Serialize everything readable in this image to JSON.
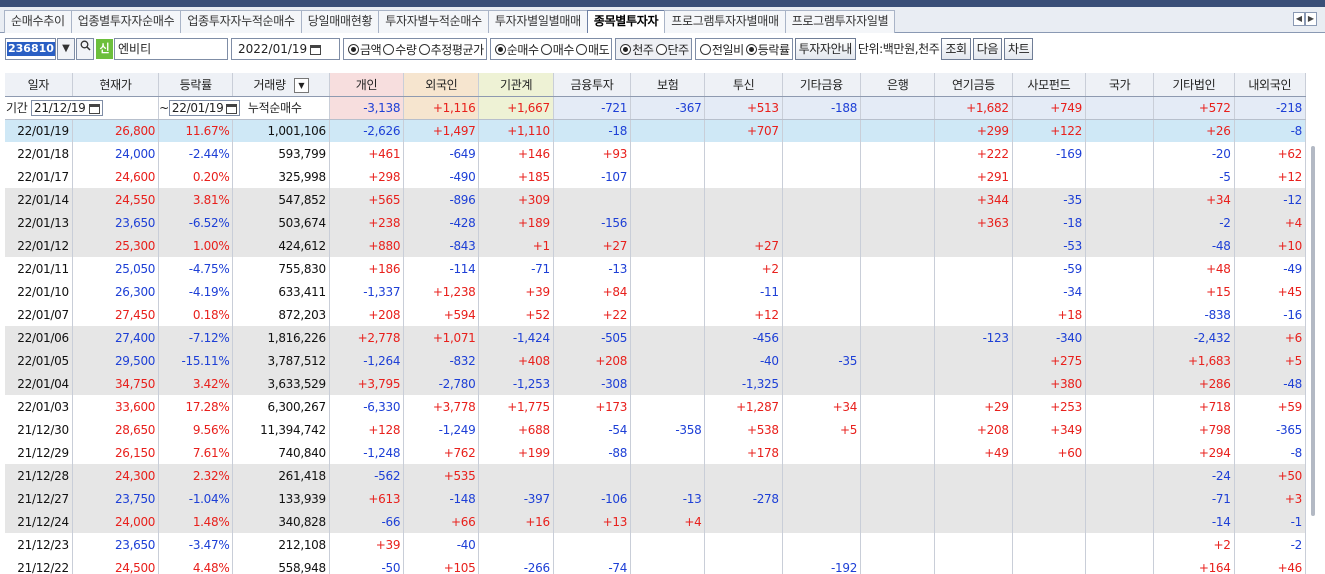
{
  "tabs": [
    {
      "label": "순매수추이",
      "active": false
    },
    {
      "label": "업종별투자자순매수",
      "active": false
    },
    {
      "label": "업종투자자누적순매수",
      "active": false
    },
    {
      "label": "당일매매현황",
      "active": false
    },
    {
      "label": "투자자별누적순매수",
      "active": false
    },
    {
      "label": "투자자별일별매매",
      "active": false
    },
    {
      "label": "종목별투자자",
      "active": true
    },
    {
      "label": "프로그램투자자별매매",
      "active": false
    },
    {
      "label": "프로그램투자자일별",
      "active": false
    }
  ],
  "tab_nav": {
    "prev": "◀",
    "next": "▶"
  },
  "toolbar": {
    "code": "236810",
    "dropdown_icon": "▼",
    "search_icon": "🔍",
    "credit_badge": "신",
    "stock_name": "엔비티",
    "date": "2022/01/19",
    "group1": [
      {
        "label": "금액",
        "on": true
      },
      {
        "label": "수량",
        "on": false
      },
      {
        "label": "추정평균가",
        "on": false
      }
    ],
    "group2": [
      {
        "label": "순매수",
        "on": true
      },
      {
        "label": "매수",
        "on": false
      },
      {
        "label": "매도",
        "on": false
      }
    ],
    "group3": [
      {
        "label": "천주",
        "on": true
      },
      {
        "label": "단주",
        "on": false
      }
    ],
    "group4": [
      {
        "label": "전일비",
        "on": false
      },
      {
        "label": "등락률",
        "on": true
      }
    ],
    "guide_button": "투자자안내",
    "unit": "단위:백만원,천주",
    "query_button": "조회",
    "next_button": "다음",
    "chart_button": "차트"
  },
  "period": {
    "label": "기간",
    "from": "21/12/19",
    "tilde": "~",
    "to": "22/01/19",
    "cumulative_label": "누적순매수"
  },
  "summary": [
    "-3,138",
    "+1,116",
    "+1,667",
    "-721",
    "-367",
    "+513",
    "-188",
    "",
    "+1,682",
    "+749",
    "",
    "+572",
    "-218"
  ],
  "headers": [
    "일자",
    "현재가",
    "등락률",
    "거래량",
    "개인",
    "외국인",
    "기관계",
    "금융투자",
    "보험",
    "투신",
    "기타금융",
    "은행",
    "연기금등",
    "사모펀드",
    "국가",
    "기타법인",
    "내외국인"
  ],
  "filter_icon": "▼",
  "rows": [
    {
      "d": "22/01/19",
      "style": "sel",
      "v": [
        "26,800",
        "11.67%",
        "1,001,106",
        "-2,626",
        "+1,497",
        "+1,110",
        "-18",
        "",
        "+707",
        "",
        "",
        "+299",
        "+122",
        "",
        "+26",
        "-8"
      ]
    },
    {
      "d": "22/01/18",
      "style": "",
      "v": [
        "24,000",
        "-2.44%",
        "593,799",
        "+461",
        "-649",
        "+146",
        "+93",
        "",
        "",
        "",
        "",
        "+222",
        "-169",
        "",
        "-20",
        "+62"
      ]
    },
    {
      "d": "22/01/17",
      "style": "",
      "v": [
        "24,600",
        "0.20%",
        "325,998",
        "+298",
        "-490",
        "+185",
        "-107",
        "",
        "",
        "",
        "",
        "+291",
        "",
        "",
        "-5",
        "+12"
      ]
    },
    {
      "d": "22/01/14",
      "style": "shade",
      "v": [
        "24,550",
        "3.81%",
        "547,852",
        "+565",
        "-896",
        "+309",
        "",
        "",
        "",
        "",
        "",
        "+344",
        "-35",
        "",
        "+34",
        "-12"
      ]
    },
    {
      "d": "22/01/13",
      "style": "shade",
      "v": [
        "23,650",
        "-6.52%",
        "503,674",
        "+238",
        "-428",
        "+189",
        "-156",
        "",
        "",
        "",
        "",
        "+363",
        "-18",
        "",
        "-2",
        "+4"
      ]
    },
    {
      "d": "22/01/12",
      "style": "shade",
      "v": [
        "25,300",
        "1.00%",
        "424,612",
        "+880",
        "-843",
        "+1",
        "+27",
        "",
        "+27",
        "",
        "",
        "",
        "-53",
        "",
        "-48",
        "+10"
      ]
    },
    {
      "d": "22/01/11",
      "style": "",
      "v": [
        "25,050",
        "-4.75%",
        "755,830",
        "+186",
        "-114",
        "-71",
        "-13",
        "",
        "+2",
        "",
        "",
        "",
        "-59",
        "",
        "+48",
        "-49"
      ]
    },
    {
      "d": "22/01/10",
      "style": "",
      "v": [
        "26,300",
        "-4.19%",
        "633,411",
        "-1,337",
        "+1,238",
        "+39",
        "+84",
        "",
        "-11",
        "",
        "",
        "",
        "-34",
        "",
        "+15",
        "+45"
      ]
    },
    {
      "d": "22/01/07",
      "style": "",
      "v": [
        "27,450",
        "0.18%",
        "872,203",
        "+208",
        "+594",
        "+52",
        "+22",
        "",
        "+12",
        "",
        "",
        "",
        "+18",
        "",
        "-838",
        "-16"
      ]
    },
    {
      "d": "22/01/06",
      "style": "shade",
      "v": [
        "27,400",
        "-7.12%",
        "1,816,226",
        "+2,778",
        "+1,071",
        "-1,424",
        "-505",
        "",
        "-456",
        "",
        "",
        "-123",
        "-340",
        "",
        "-2,432",
        "+6"
      ]
    },
    {
      "d": "22/01/05",
      "style": "shade",
      "v": [
        "29,500",
        "-15.11%",
        "3,787,512",
        "-1,264",
        "-832",
        "+408",
        "+208",
        "",
        "-40",
        "-35",
        "",
        "",
        "+275",
        "",
        "+1,683",
        "+5"
      ]
    },
    {
      "d": "22/01/04",
      "style": "shade",
      "v": [
        "34,750",
        "3.42%",
        "3,633,529",
        "+3,795",
        "-2,780",
        "-1,253",
        "-308",
        "",
        "-1,325",
        "",
        "",
        "",
        "+380",
        "",
        "+286",
        "-48"
      ]
    },
    {
      "d": "22/01/03",
      "style": "",
      "v": [
        "33,600",
        "17.28%",
        "6,300,267",
        "-6,330",
        "+3,778",
        "+1,775",
        "+173",
        "",
        "+1,287",
        "+34",
        "",
        "+29",
        "+253",
        "",
        "+718",
        "+59"
      ]
    },
    {
      "d": "21/12/30",
      "style": "",
      "v": [
        "28,650",
        "9.56%",
        "11,394,742",
        "+128",
        "-1,249",
        "+688",
        "-54",
        "-358",
        "+538",
        "+5",
        "",
        "+208",
        "+349",
        "",
        "+798",
        "-365"
      ]
    },
    {
      "d": "21/12/29",
      "style": "",
      "v": [
        "26,150",
        "7.61%",
        "740,840",
        "-1,248",
        "+762",
        "+199",
        "-88",
        "",
        "+178",
        "",
        "",
        "+49",
        "+60",
        "",
        "+294",
        "-8"
      ]
    },
    {
      "d": "21/12/28",
      "style": "shade",
      "v": [
        "24,300",
        "2.32%",
        "261,418",
        "-562",
        "+535",
        "",
        "",
        "",
        "",
        "",
        "",
        "",
        "",
        "",
        "-24",
        "+50"
      ]
    },
    {
      "d": "21/12/27",
      "style": "shade",
      "v": [
        "23,750",
        "-1.04%",
        "133,939",
        "+613",
        "-148",
        "-397",
        "-106",
        "-13",
        "-278",
        "",
        "",
        "",
        "",
        "",
        "-71",
        "+3"
      ]
    },
    {
      "d": "21/12/24",
      "style": "shade",
      "v": [
        "24,000",
        "1.48%",
        "340,828",
        "-66",
        "+66",
        "+16",
        "+13",
        "+4",
        "",
        "",
        "",
        "",
        "",
        "",
        "-14",
        "-1"
      ]
    },
    {
      "d": "21/12/23",
      "style": "",
      "v": [
        "23,650",
        "-3.47%",
        "212,108",
        "+39",
        "-40",
        "",
        "",
        "",
        "",
        "",
        "",
        "",
        "",
        "",
        "+2",
        "-2"
      ]
    },
    {
      "d": "21/12/22",
      "style": "",
      "v": [
        "24,500",
        "4.48%",
        "558,948",
        "-50",
        "+105",
        "-266",
        "-74",
        "",
        "",
        "-192",
        "",
        "",
        "",
        "",
        "+164",
        "+46"
      ]
    }
  ],
  "colors": {
    "positive": "#e8201c",
    "negative": "#1d3fd6",
    "selected_row": "#cfe8f6",
    "shaded_row": "#e6e6e6",
    "active_tab": "#ffffff"
  }
}
